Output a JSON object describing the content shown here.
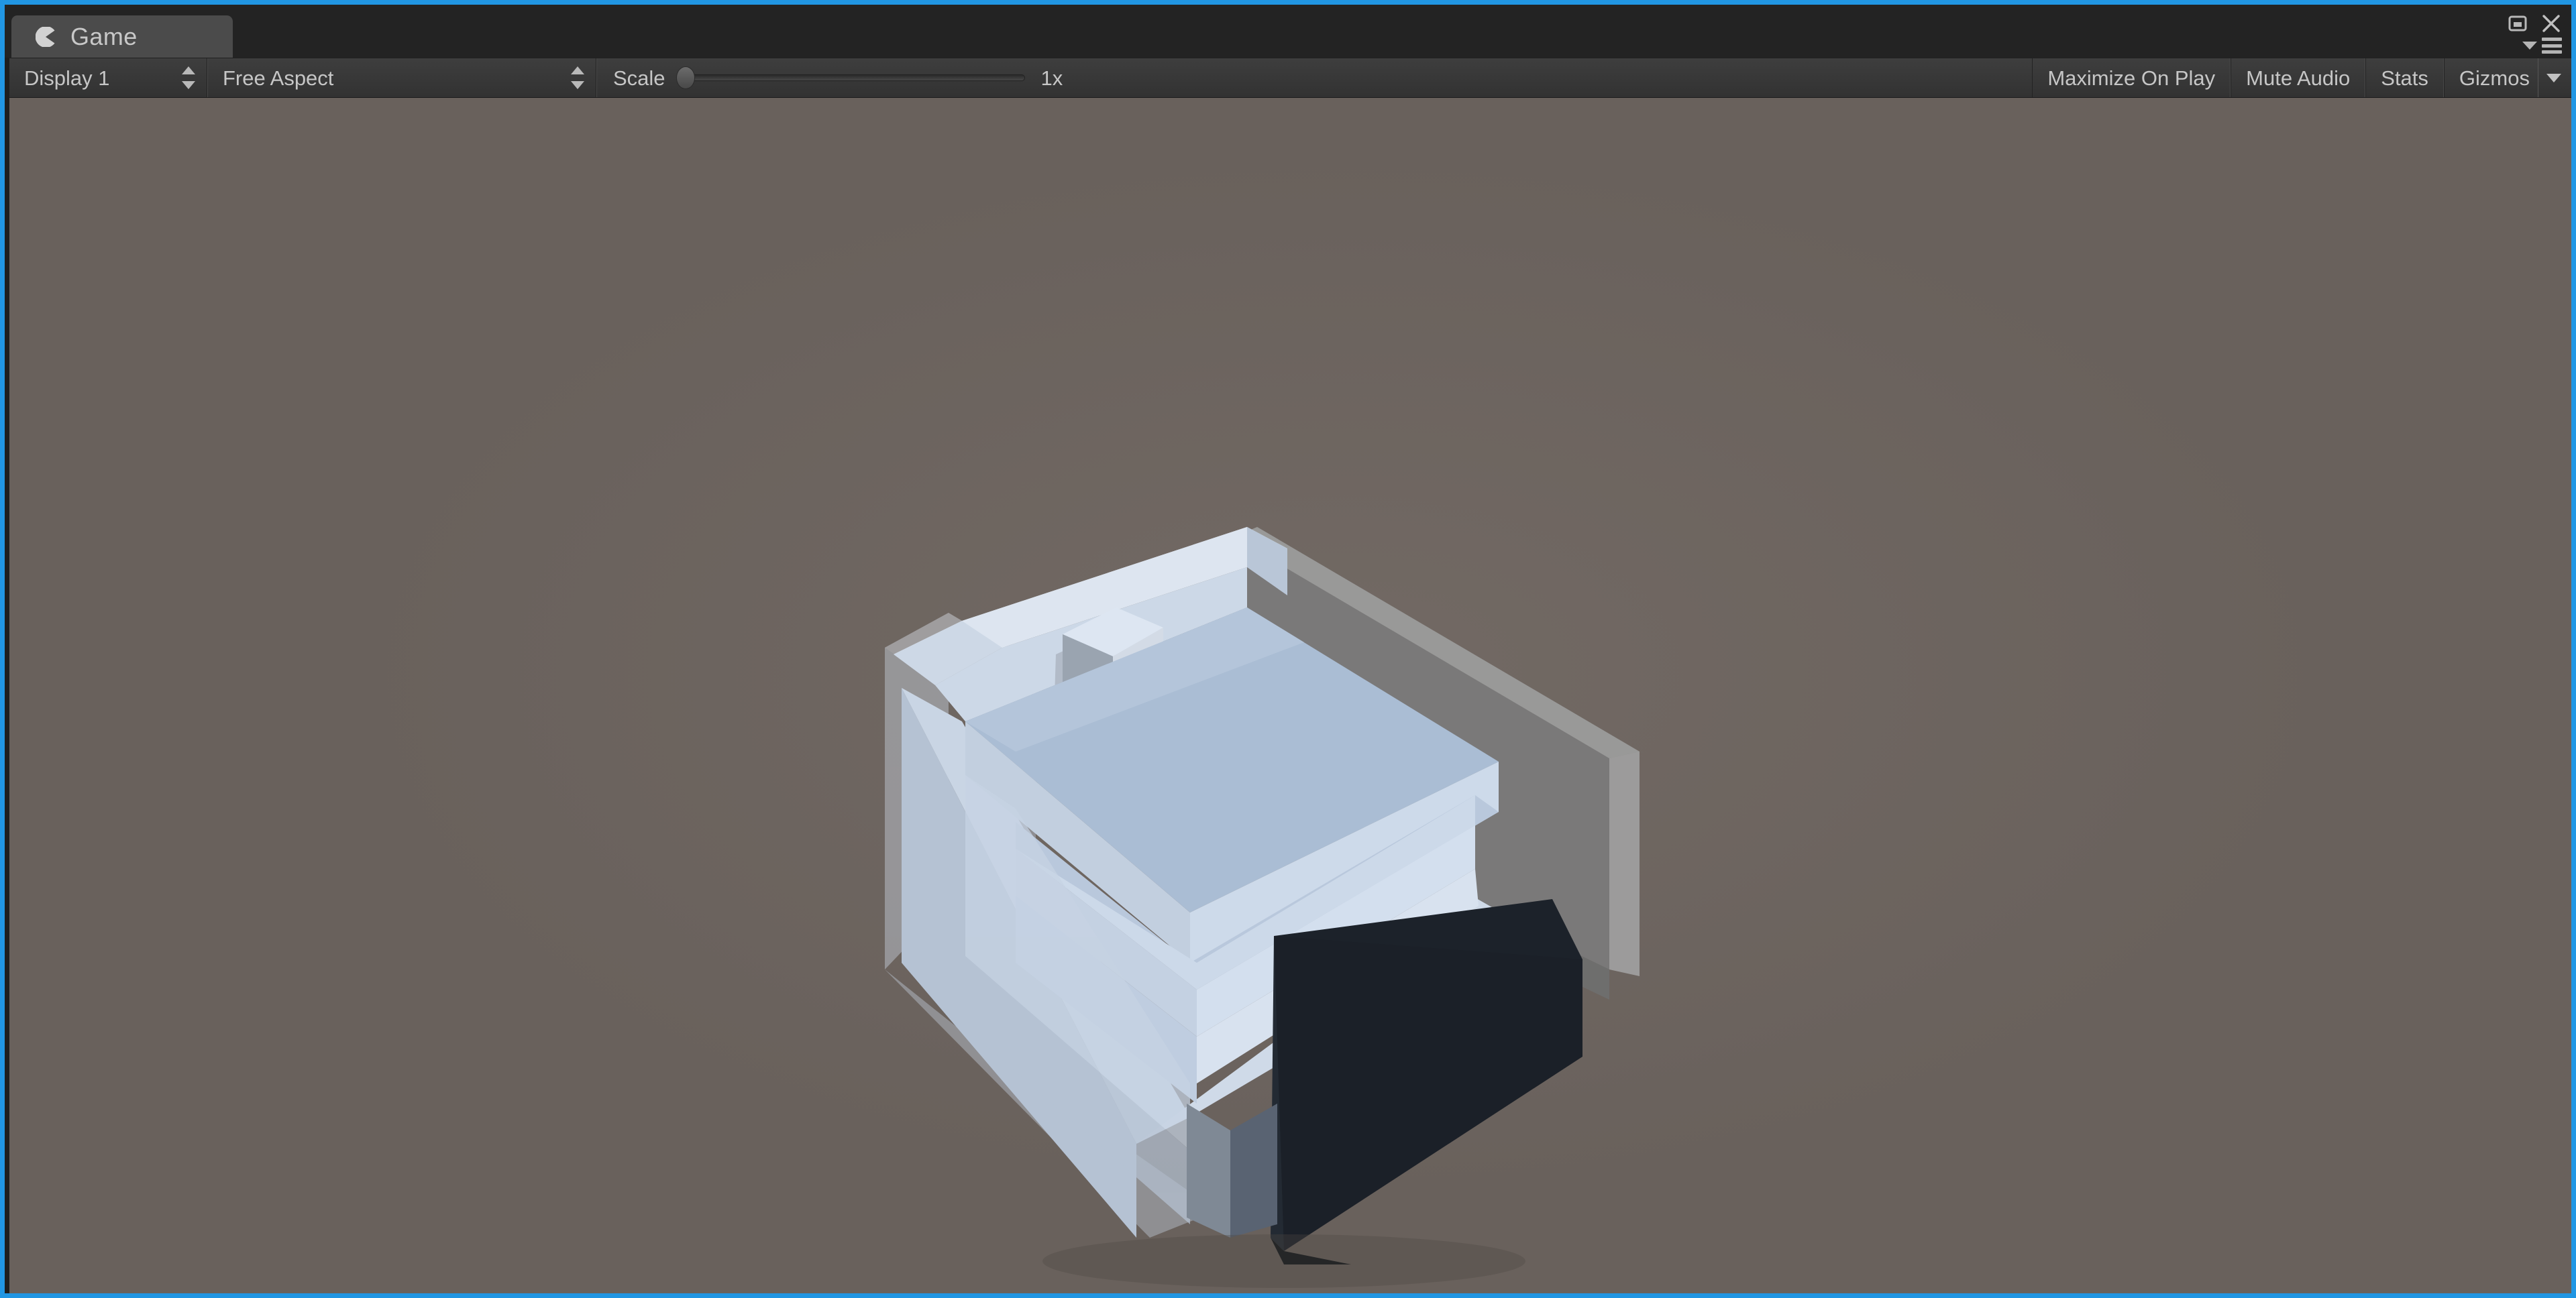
{
  "window": {
    "tab_label": "Game",
    "tab_icon": "game-pacman-icon",
    "maximize_icon": "maximize-restore-icon",
    "close_icon": "close-x-icon",
    "menu_dropdown_icon": "chevron-down-icon",
    "menu_hamburger_icon": "hamburger-menu-icon",
    "focus_border_color": "#2196e3"
  },
  "toolbar": {
    "display_label": "Display 1",
    "display_icon": "updown-popup-icon",
    "aspect_label": "Free Aspect",
    "aspect_icon": "updown-popup-icon",
    "scale_label": "Scale",
    "scale_value": "1x",
    "scale_slider_position_percent": 0,
    "maximize_on_play_label": "Maximize On Play",
    "mute_audio_label": "Mute Audio",
    "stats_label": "Stats",
    "gizmos_label": "Gizmos",
    "gizmos_dropdown_icon": "chevron-down-icon"
  },
  "viewport": {
    "background_color": "#69615c",
    "scene_name": "low-poly-bed-scene",
    "objects": [
      {
        "name": "wall-panel-right",
        "color": "#7a7a7a",
        "edge_color": "#9b9b9b"
      },
      {
        "name": "bed-frame-base",
        "color": "#ccd7e6"
      },
      {
        "name": "mattress",
        "color": "#aabdd4",
        "side_color": "#c6d3e3"
      },
      {
        "name": "headboard",
        "color": "#dbe4ef",
        "face_color": "#c9d5e4"
      },
      {
        "name": "pillow-cube",
        "color": "#d5dfec",
        "side_color": "#9aa4b0"
      },
      {
        "name": "footer-dark-box",
        "color": "#1c222a"
      },
      {
        "name": "ghost-duplicate-frame",
        "color": "#c3cfdd",
        "opacity": 0.45
      }
    ]
  }
}
